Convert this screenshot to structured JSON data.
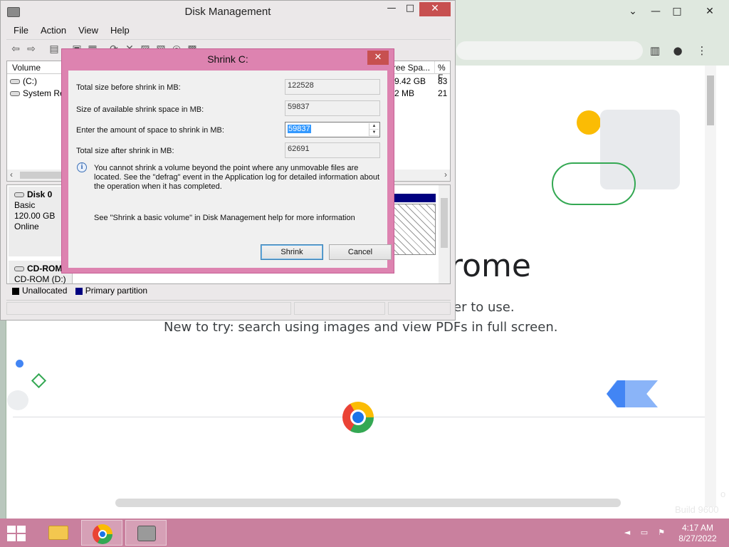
{
  "chrome": {
    "hero_partial": "rome",
    "hero_sub_partial": "ier to use.",
    "hero_new": "New to try: search using images and view PDFs in full screen.",
    "build_partial": "Build 9600",
    "build_edge": "o"
  },
  "disk_mgmt": {
    "title": "Disk Management",
    "menu": [
      "File",
      "Action",
      "View",
      "Help"
    ],
    "columns": [
      "Volume",
      "ree Spa...",
      "% F"
    ],
    "volumes": [
      {
        "name": "(C:)",
        "free": "9.42 GB",
        "pct": "83"
      },
      {
        "name": "System Res",
        "free": "2 MB",
        "pct": "21"
      }
    ],
    "disks": [
      {
        "name": "Disk 0",
        "type": "Basic",
        "size": "120.00 GB",
        "status": "Online"
      },
      {
        "name": "CD-ROM",
        "type": "CD-ROM (D:)"
      }
    ],
    "legend": [
      "Unallocated",
      "Primary partition"
    ]
  },
  "dialog": {
    "title": "Shrink C:",
    "labels": [
      "Total size before shrink in MB:",
      "Size of available shrink space in MB:",
      "Enter the amount of space to shrink in MB:",
      "Total size after shrink in MB:"
    ],
    "total_before": "122528",
    "available": "59837",
    "shrink_amount": "59837",
    "total_after": "62691",
    "info": "You cannot shrink a volume beyond the point where any unmovable files are located. See the \"defrag\" event in the Application log for detailed information about the operation when it has completed.",
    "help": "See \"Shrink a basic volume\" in Disk Management help for more information",
    "shrink_button": "Shrink",
    "cancel_button": "Cancel"
  },
  "taskbar": {
    "time": "4:17 AM",
    "date": "8/27/2022"
  }
}
